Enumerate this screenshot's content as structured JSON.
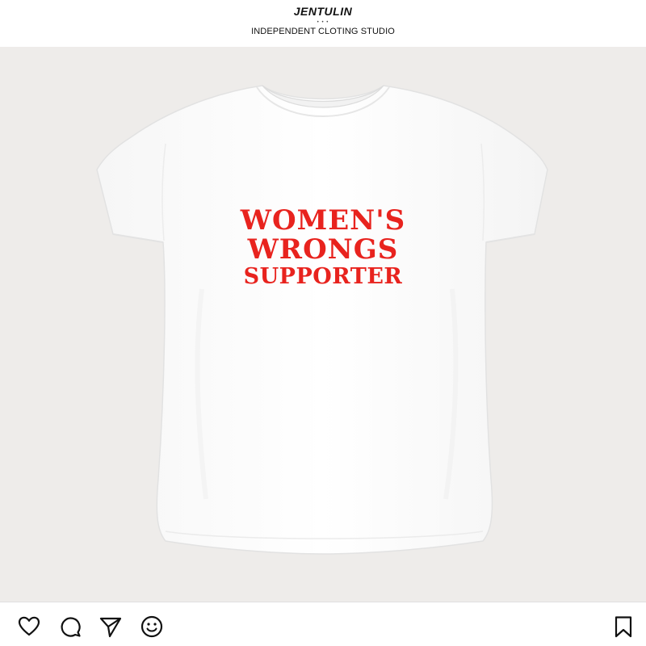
{
  "header": {
    "brand_name": "JENTULIN",
    "brand_dots": "• • •",
    "tagline": "INDEPENDENT CLOTING STUDIO"
  },
  "product": {
    "garment": "white t-shirt",
    "print_lines": [
      "WOMEN'S",
      "WRONGS",
      "SUPPORTER"
    ],
    "print_color": "#e8231e",
    "background_color": "#eeecea"
  },
  "action_bar": {
    "icons": [
      "heart-icon",
      "comment-icon",
      "share-icon",
      "emoji-icon",
      "bookmark-icon"
    ]
  }
}
